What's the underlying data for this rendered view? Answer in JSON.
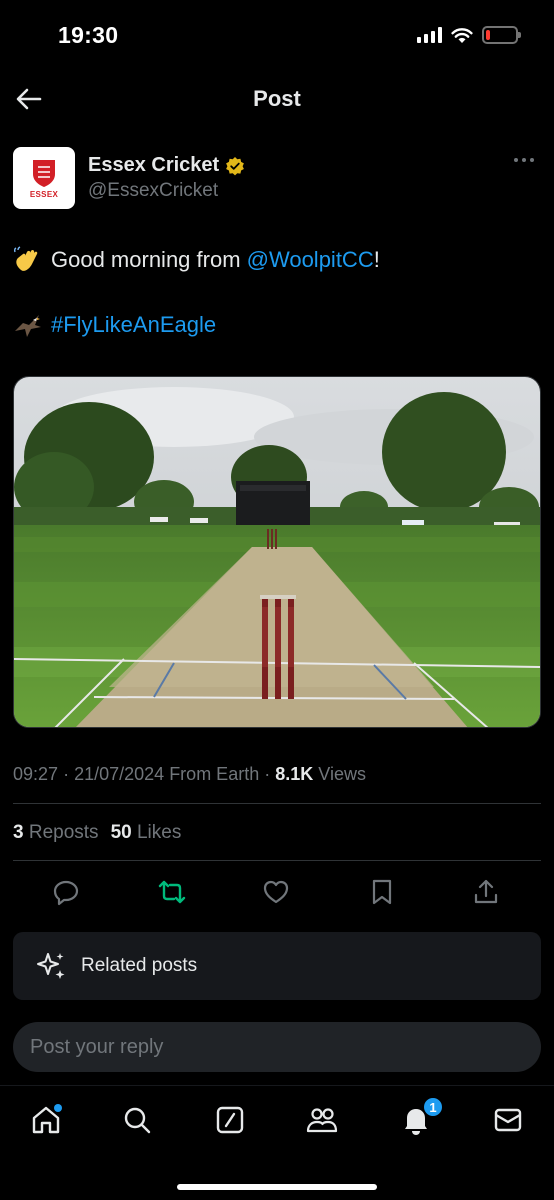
{
  "status_bar": {
    "time": "19:30",
    "icons": [
      "cellular-signal-icon",
      "wifi-icon",
      "battery-icon"
    ],
    "battery_level": 0.15,
    "battery_color": "#ff3b30"
  },
  "header": {
    "title": "Post",
    "back_icon": "arrow-left-icon"
  },
  "author": {
    "name": "Essex Cricket",
    "handle": "@EssexCricket",
    "verified_color": "#e2b719",
    "avatar_text": "ESSEX",
    "avatar_color": "#d21f26"
  },
  "tweet": {
    "line1_prefix": "Good morning from ",
    "line1_mention": "@WoolpitCC",
    "line1_suffix": "!",
    "line2_hashtag": "#FlyLikeAnEagle",
    "emoji1": "waving-hand-emoji",
    "emoji2": "eagle-emoji",
    "image_description_icon": "cricket-pitch-photo"
  },
  "meta": {
    "time": "09:27",
    "separator": "·",
    "date": "21/07/2024",
    "source": "From Earth",
    "views_count": "8.1K",
    "views_label": "Views"
  },
  "stats": {
    "reposts_count": "3",
    "reposts_label": "Reposts",
    "likes_count": "50",
    "likes_label": "Likes"
  },
  "actions": [
    "reply-icon",
    "repost-icon",
    "like-icon",
    "bookmark-icon",
    "share-icon"
  ],
  "related": {
    "label": "Related posts",
    "icon": "sparkle-icon"
  },
  "reply": {
    "placeholder": "Post your reply"
  },
  "bottom_nav": {
    "items": [
      "home-icon",
      "search-icon",
      "grok-icon",
      "communities-icon",
      "notifications-icon",
      "messages-icon"
    ],
    "notifications_badge": "1"
  },
  "colors": {
    "accent": "#1d9bf0",
    "repost_active": "#00ba7c",
    "text_secondary": "#71767b",
    "background": "#000000"
  }
}
